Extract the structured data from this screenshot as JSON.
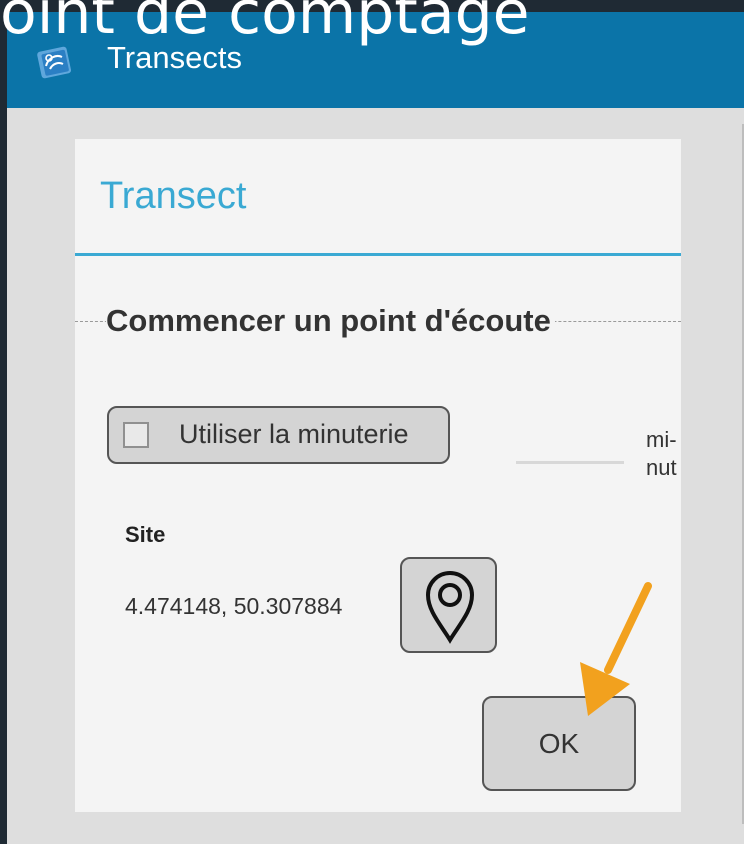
{
  "slide": {
    "title": "oint de comptage"
  },
  "appbar": {
    "title": "Transects",
    "icon": "app-logo-icon",
    "color": "#0b74a8"
  },
  "dialog": {
    "title": "Transect",
    "accent_color": "#3aa9d3",
    "section_heading": "Commencer un point d'écoute",
    "timer": {
      "label": "Utiliser la minuterie",
      "checked": false,
      "minutes_value": "",
      "minutes_unit": "mi-nut"
    },
    "site": {
      "label": "Site",
      "coordinates": "4.474148, 50.307884",
      "location_icon": "map-pin-icon"
    },
    "ok_label": "OK"
  },
  "annotation": {
    "arrow_icon": "arrow-pointer-icon",
    "color": "#f2a11e"
  }
}
